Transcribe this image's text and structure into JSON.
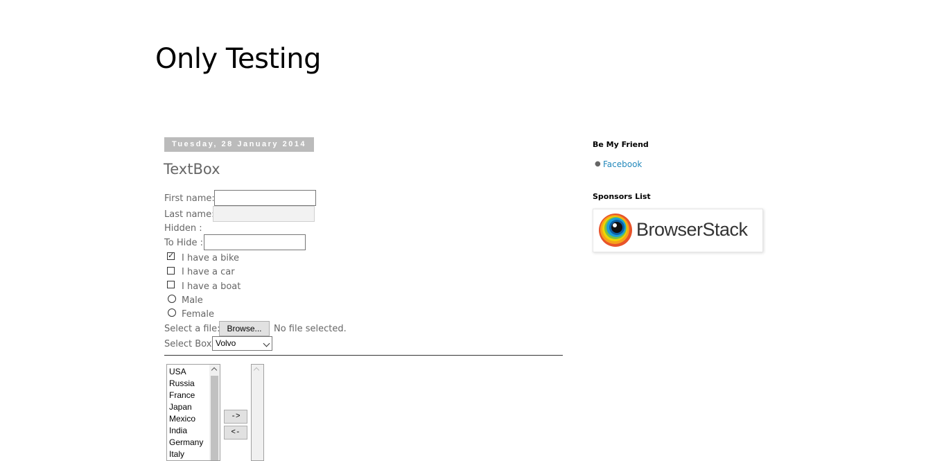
{
  "header": {
    "title": "Only Testing"
  },
  "post": {
    "date": "Tuesday, 28 January 2014",
    "title": "TextBox",
    "form": {
      "first_name_label": "First name:",
      "first_name_value": "",
      "last_name_label": "Last name:",
      "last_name_value": "",
      "hidden_label": "Hidden :",
      "to_hide_label": "To Hide :",
      "to_hide_value": "",
      "checkboxes": [
        {
          "label": "I have a bike",
          "checked": true
        },
        {
          "label": "I have a car",
          "checked": false
        },
        {
          "label": "I have a boat",
          "checked": false
        }
      ],
      "radios": [
        {
          "label": "Male",
          "checked": false
        },
        {
          "label": "Female",
          "checked": false
        }
      ],
      "file_label": "Select a file:",
      "browse_button": "Browse...",
      "file_status": "No file selected.",
      "select_label": "Select Box:",
      "select_value": "Volvo"
    },
    "list_transfer": {
      "left_items": [
        "USA",
        "Russia",
        "France",
        "Japan",
        "Mexico",
        "India",
        "Germany",
        "Italy"
      ],
      "move_right_button": "->",
      "move_left_button": "<-",
      "right_items": []
    }
  },
  "sidebar": {
    "friend_heading": "Be My Friend",
    "friend_links": [
      "Facebook"
    ],
    "sponsors_heading": "Sponsors List",
    "sponsor_name": "BrowserStack"
  },
  "colors": {
    "link": "#2288bb",
    "date_header_bg": "#bbbbbb",
    "text": "#666666"
  }
}
